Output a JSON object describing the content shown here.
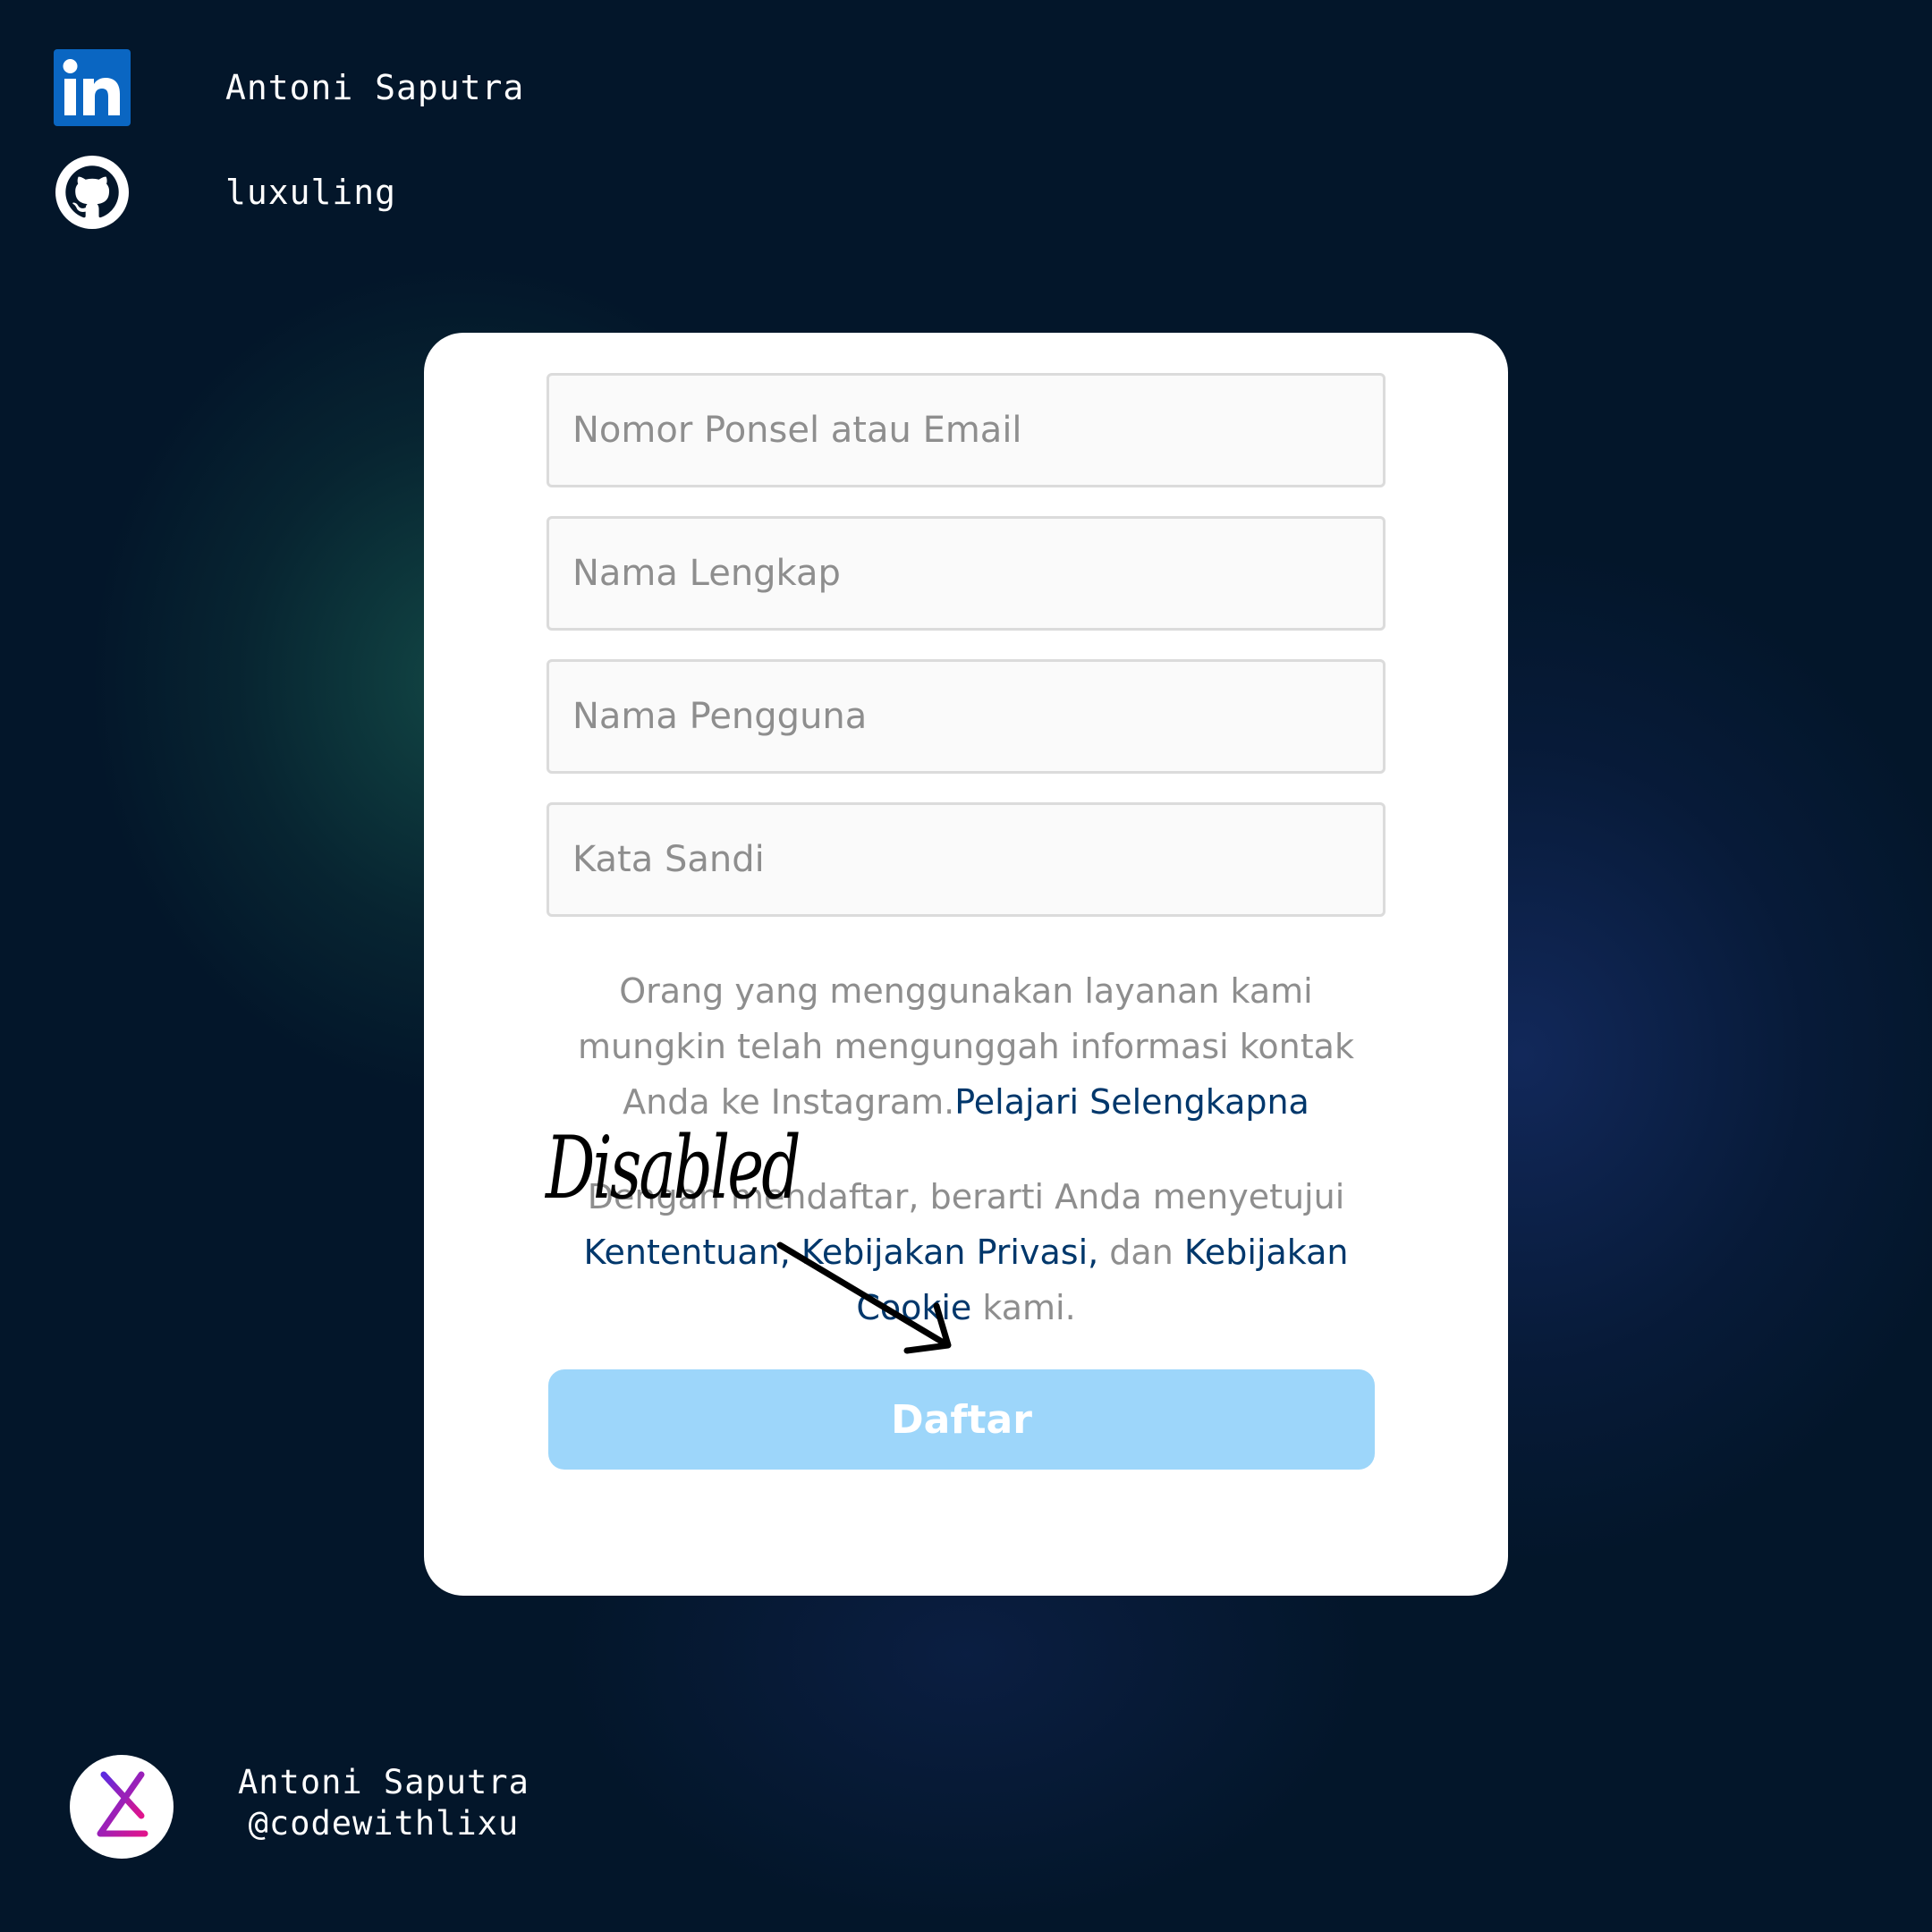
{
  "social": {
    "linkedin": {
      "icon": "linkedin-icon",
      "label": "Antoni Saputra",
      "color": "#0a66c2"
    },
    "github": {
      "icon": "github-icon",
      "label": "luxuling"
    }
  },
  "form": {
    "fields": [
      {
        "placeholder": "Nomor Ponsel atau Email",
        "value": ""
      },
      {
        "placeholder": "Nama Lengkap",
        "value": ""
      },
      {
        "placeholder": "Nama Pengguna",
        "value": ""
      },
      {
        "placeholder": "Kata Sandi",
        "value": ""
      }
    ],
    "info_text": "Orang yang menggunakan layanan kami mungkin telah mengunggah informasi kontak Anda ke Instagram.",
    "info_link": "Pelajari Selengkapna",
    "terms_prefix": "Dengan mendaftar, berarti Anda menyetujui ",
    "terms_link_1": "Kententuan, Kebijakan Privasi,",
    "terms_middle": " dan ",
    "terms_link_2": "Kebijakan Cookie",
    "terms_suffix": " kami.",
    "submit_label": "Daftar",
    "submit_state": "disabled",
    "submit_color": "#9dd6fa"
  },
  "annotation": {
    "label": "Disabled",
    "arrow_icon": "arrow-icon"
  },
  "footer": {
    "avatar_icon": "logo-icon",
    "name": "Antoni Saputra",
    "handle": "@codewithlixu"
  }
}
